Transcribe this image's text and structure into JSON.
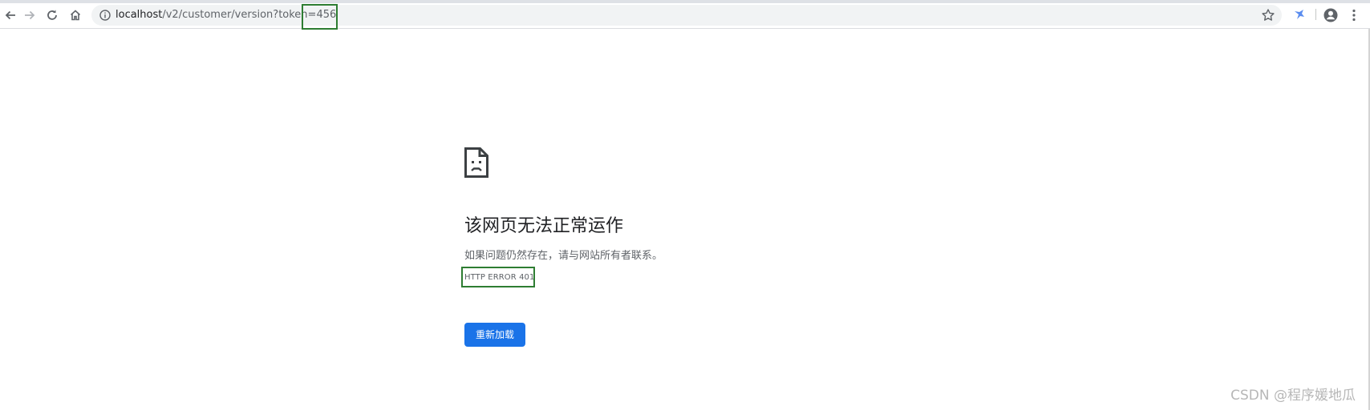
{
  "browser": {
    "url_host": "localhost",
    "url_path": "/v2/customer/version?token=456",
    "icons": {
      "back": "arrow-left-icon",
      "forward": "arrow-right-icon",
      "reload": "reload-icon",
      "home": "home-icon",
      "site_info": "info-icon",
      "bookmark": "star-icon",
      "extension": "extension-icon",
      "profile": "account-icon",
      "menu": "more-vert-icon"
    }
  },
  "error_page": {
    "icon": "sad-page-icon",
    "heading": "该网页无法正常运作",
    "message": "如果问题仍然存在，请与网站所有者联系。",
    "error_code": "HTTP ERROR 401",
    "reload_label": "重新加载"
  },
  "watermark": "CSDN @程序媛地瓜",
  "colors": {
    "accent": "#1a73e8",
    "highlight_box": "#2e7d32"
  }
}
